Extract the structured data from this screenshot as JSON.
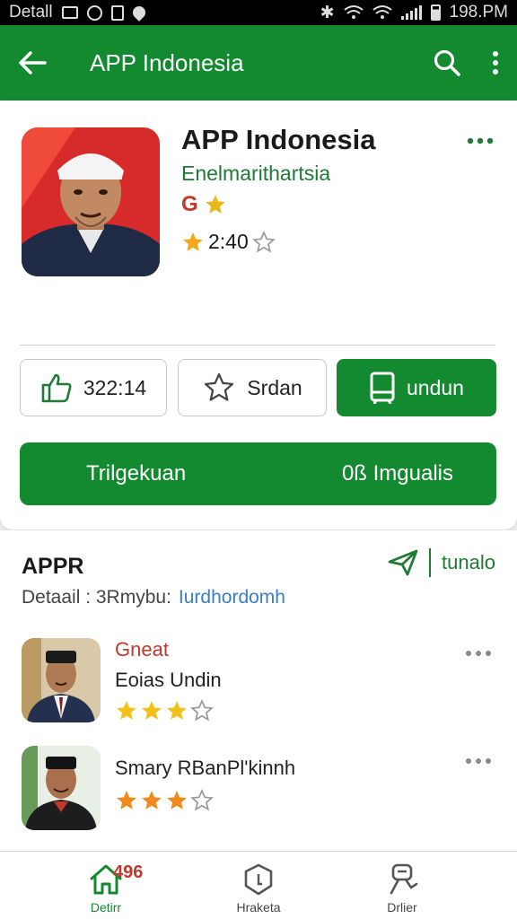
{
  "status_bar": {
    "left_text": "Detall",
    "time": "198.PM"
  },
  "app_bar": {
    "title": "APP Indonesia"
  },
  "app": {
    "name": "APP Indonesia",
    "developer": "Enelmarithartsia",
    "badge_text": "G",
    "rating_text": "2:40"
  },
  "actions": {
    "like_count": "322:14",
    "save_label": "Srdan",
    "install_label": "undun"
  },
  "wide_button": {
    "left_label": "Trilgekuan",
    "right_label": "0ß Imgualis"
  },
  "reviews_section": {
    "title": "APPR",
    "action_label": "tunalo",
    "subtitle": "Detaail : 3Rmybu:",
    "subtitle_link": "Iurdhordomh",
    "items": [
      {
        "label": "Gneat",
        "name": "Eoias Undin",
        "stars": 3
      },
      {
        "label": "",
        "name": "Smary RBanPl'kinnh",
        "stars": 3
      }
    ]
  },
  "bottom_nav": {
    "home_badge": "496",
    "home_label": "Detirr",
    "mid_label": "Hraketa",
    "right_label": "Drlier"
  },
  "colors": {
    "brand_green": "#138a2f",
    "accent_red": "#c0392b",
    "star_yellow": "#f2c21b",
    "star_orange": "#f08a1c"
  }
}
